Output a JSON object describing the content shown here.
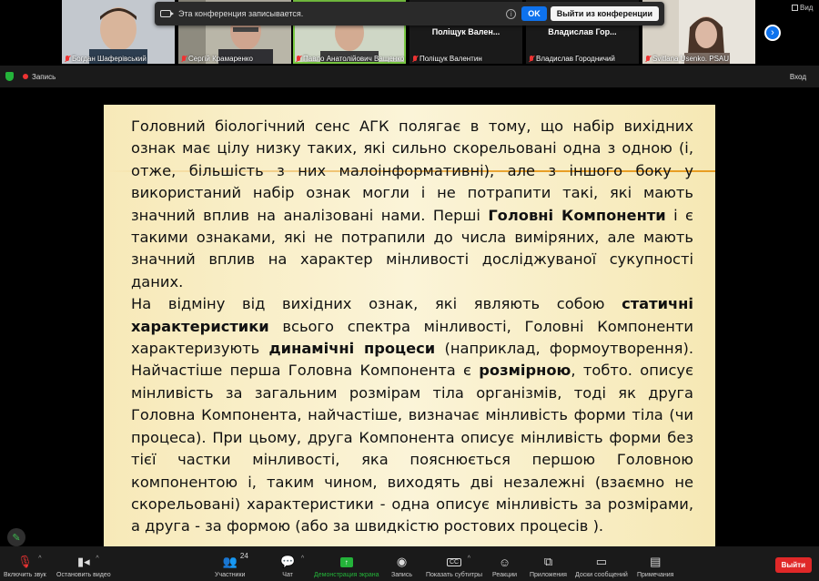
{
  "gallery": {
    "participants": [
      {
        "name": "Богдан Шаферівський",
        "muted": true
      },
      {
        "name": "Сергій Крамаренко",
        "muted": true
      },
      {
        "name": "Павло Анатолійович Ващенко",
        "muted": true,
        "active": true
      },
      {
        "name": "Поліщук Валентин",
        "tile_label": "Поліщук Вален...",
        "muted": true
      },
      {
        "name": "Владислав Городничий",
        "tile_label": "Владислав Гор...",
        "muted": true
      },
      {
        "name": "Svitlana Usenko. PSAU",
        "muted": true
      }
    ],
    "view_label": "Вид"
  },
  "recording_banner": {
    "text": "Эта конференция записывается.",
    "ok_label": "OK",
    "leave_label": "Выйти из конференции"
  },
  "status_bar": {
    "recording_label": "Запись",
    "exit_label": "Вход"
  },
  "slide": {
    "paragraph1_a": "Головний біологічний сенс АГК полягає в тому, що набір вихідних ознак має цілу низку таких, які сильно скорельовані одна з одною (і, отже, більшість з них малоінформативні), але з іншого боку у використаний набір ознак могли і не потрапити такі, які мають значний вплив на аналізовані нами. Перші ",
    "paragraph1_bold": "Головні Компоненти",
    "paragraph1_b": " і є такими ознаками, які не потрапили до числа виміряних, але мають значний вплив на характер мінливості досліджуваної сукупності даних.",
    "paragraph2_a": "На відміну від вихідних ознак, які являють собою ",
    "paragraph2_bold1": "статичні характеристики",
    "paragraph2_b": " всього спектра мінливості, Головні Компоненти характеризують ",
    "paragraph2_bold2": "динамічні процеси",
    "paragraph2_c": " (наприклад, формоутворення). Найчастіше перша Головна Компонента є ",
    "paragraph2_bold3": "розмірною",
    "paragraph2_d": ", тобто. описує мінливість за загальним розмірам тіла організмів, тоді як друга Головна Компонента, найчастіше, визначає мінливість форми тіла (чи процеса). При цьому, друга Компонента описує мінливість форми без тієї частки мінливості, яка пояснюється першою Головною компонентою і, таким чином, виходять дві незалежні (взаємно не скорельовані) характеристики - одна описує мінливість за розмірами, а друга - за формою (або за швидкістю ростових процесів )."
  },
  "toolbar": {
    "audio_label": "Включить звук",
    "video_label": "Остановить видео",
    "participants_label": "Участники",
    "participants_count": "24",
    "chat_label": "Чат",
    "share_label": "Демонстрация экрана",
    "record_label": "Запись",
    "captions_label": "Показать субтитры",
    "reactions_label": "Реакции",
    "apps_label": "Приложения",
    "whiteboard_label": "Доски сообщений",
    "notes_label": "Примечания",
    "leave_label": "Выйти",
    "cc_icon": "CC"
  },
  "colors": {
    "accent_blue": "#0e72ed",
    "share_green": "#24b33a",
    "leave_red": "#e02828",
    "slide_bg": "#f7e9b8"
  }
}
